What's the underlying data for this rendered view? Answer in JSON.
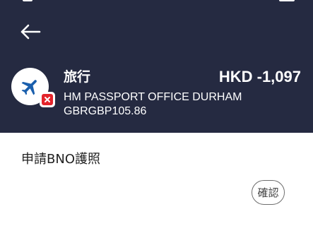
{
  "header": {
    "category": "旅行",
    "amount": "HKD -1,097",
    "merchant": "HM PASSPORT OFFICE DURHAM",
    "reference": "GBRGBP105.86"
  },
  "icons": {
    "back": "arrow-left-icon",
    "category": "airplane-icon",
    "status": "declined-x-icon"
  },
  "note": {
    "text": "申請BNO護照"
  },
  "actions": {
    "confirm_label": "確認"
  },
  "colors": {
    "header_bg": "#252a41",
    "category_icon": "#1a5fad",
    "badge_red": "#e3242b"
  }
}
